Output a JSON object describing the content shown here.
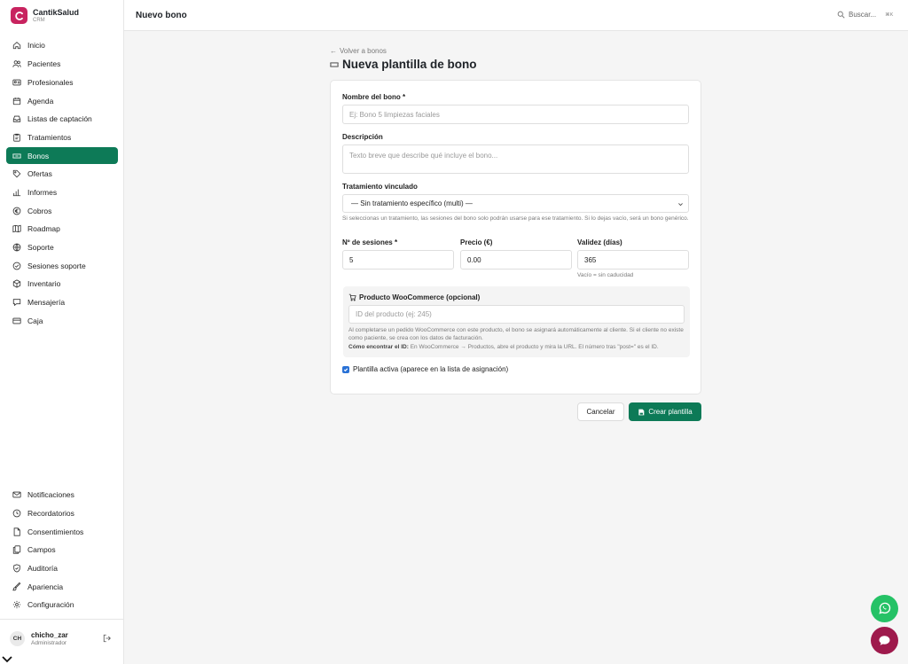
{
  "brand": {
    "name": "CantikSalud",
    "subtitle": "CRM"
  },
  "header": {
    "title": "Nuevo bono",
    "search_label": "Buscar...",
    "search_shortcut": "⌘K"
  },
  "sidebar": {
    "items": [
      {
        "label": "Inicio",
        "icon": "home-icon"
      },
      {
        "label": "Pacientes",
        "icon": "users-icon"
      },
      {
        "label": "Profesionales",
        "icon": "id-card-icon"
      },
      {
        "label": "Agenda",
        "icon": "calendar-icon"
      },
      {
        "label": "Listas de captación",
        "icon": "inbox-icon"
      },
      {
        "label": "Tratamientos",
        "icon": "clipboard-icon"
      },
      {
        "label": "Bonos",
        "icon": "ticket-icon",
        "active": true
      },
      {
        "label": "Ofertas",
        "icon": "tag-icon"
      },
      {
        "label": "Informes",
        "icon": "bar-chart-icon"
      },
      {
        "label": "Cobros",
        "icon": "euro-icon"
      },
      {
        "label": "Roadmap",
        "icon": "map-icon"
      },
      {
        "label": "Soporte",
        "icon": "globe-icon"
      },
      {
        "label": "Sesiones soporte",
        "icon": "check-circle-icon"
      },
      {
        "label": "Inventario",
        "icon": "box-icon"
      },
      {
        "label": "Mensajería",
        "icon": "message-icon"
      },
      {
        "label": "Caja",
        "icon": "cash-icon"
      }
    ],
    "bottom_items": [
      {
        "label": "Notificaciones",
        "icon": "mail-icon"
      },
      {
        "label": "Recordatorios",
        "icon": "clock-icon"
      },
      {
        "label": "Consentimientos",
        "icon": "file-icon"
      },
      {
        "label": "Campos",
        "icon": "files-icon"
      },
      {
        "label": "Auditoría",
        "icon": "shield-icon"
      },
      {
        "label": "Apariencia",
        "icon": "brush-icon"
      },
      {
        "label": "Configuración",
        "icon": "gear-icon"
      }
    ],
    "user": {
      "initials": "CH",
      "name": "chicho_zar",
      "role": "Administrador"
    }
  },
  "page": {
    "back_label": "Volver a bonos",
    "title": "Nueva plantilla de bono"
  },
  "form": {
    "name_label": "Nombre del bono *",
    "name_placeholder": "Ej: Bono 5 limpiezas faciales",
    "description_label": "Descripción",
    "description_placeholder": "Texto breve que describe qué incluye el bono...",
    "treatment_label": "Tratamiento vinculado",
    "treatment_value": "— Sin tratamiento específico (multi) —",
    "treatment_hint": "Si seleccionas un tratamiento, las sesiones del bono solo podrán usarse para ese tratamiento. Si lo dejas vacío, será un bono genérico.",
    "sessions_label": "Nº de sesiones *",
    "sessions_value": "5",
    "price_label": "Precio (€)",
    "price_value": "0.00",
    "validity_label": "Validez (días)",
    "validity_value": "365",
    "validity_hint": "Vacío = sin caducidad",
    "woo_label": "Producto WooCommerce (opcional)",
    "woo_placeholder": "ID del producto (ej: 245)",
    "woo_hint": "Al completarse un pedido WooCommerce con este producto, el bono se asignará automáticamente al cliente. Si el cliente no existe como paciente, se crea con los datos de facturación.",
    "woo_find_strong": "Cómo encontrar el ID:",
    "woo_find_text": "En WooCommerce → Productos, abre el producto y mira la URL. El número tras \"post=\" es el ID.",
    "active_label": "Plantilla activa (aparece en la lista de asignación)",
    "active_checked": true
  },
  "actions": {
    "cancel_label": "Cancelar",
    "create_label": "Crear plantilla"
  },
  "colors": {
    "accent": "#0d7a57",
    "brand": "#c8235f",
    "whatsapp": "#25c266",
    "chat": "#9e1a4c"
  }
}
